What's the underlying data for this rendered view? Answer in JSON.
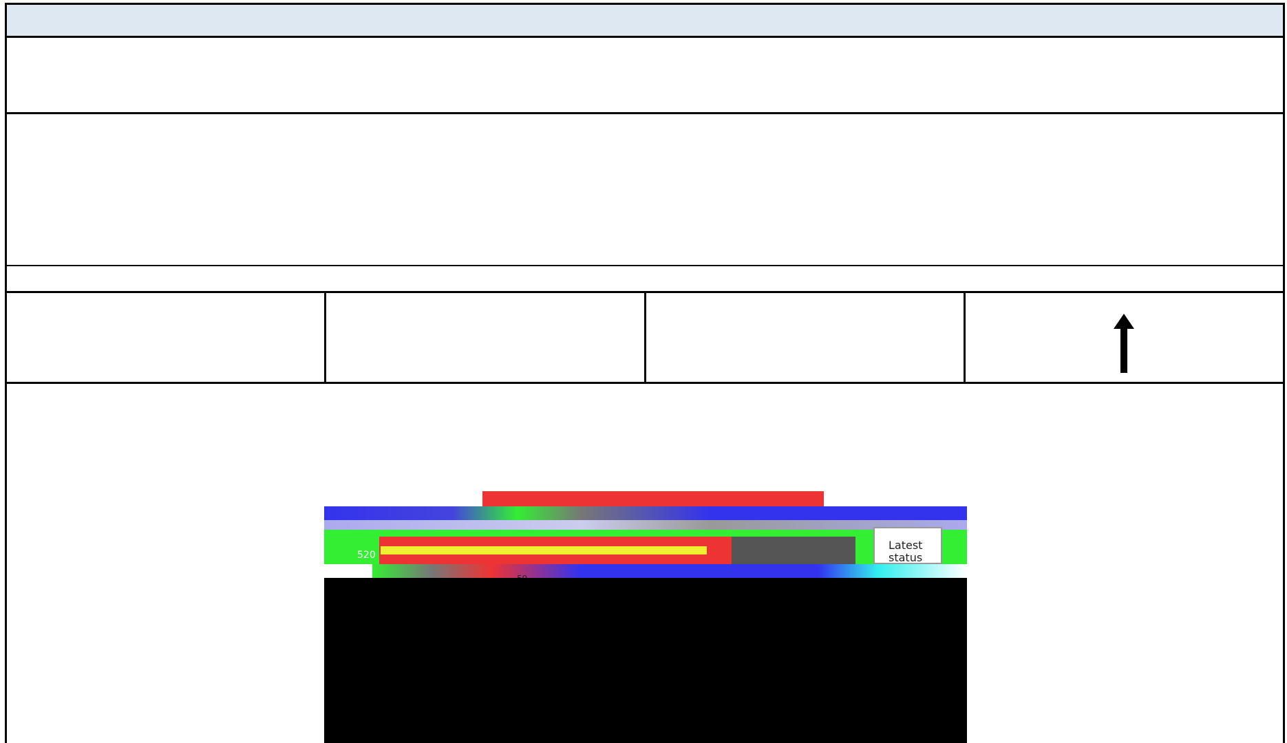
{
  "header": {
    "title": ""
  },
  "cells": [
    {
      "label": ""
    },
    {
      "label": ""
    },
    {
      "label": ""
    },
    {
      "label": "",
      "icon": "arrow-up-icon"
    }
  ],
  "embedded_view": {
    "value_left": "520",
    "value_bottom": "59",
    "status_label": "Latest status",
    "colors": {
      "red": "#ee3333",
      "blue": "#3333ee",
      "green": "#33ee33",
      "yellow": "#eeee33",
      "gray": "#555555",
      "cyan": "#33eeee",
      "black": "#000000"
    }
  }
}
